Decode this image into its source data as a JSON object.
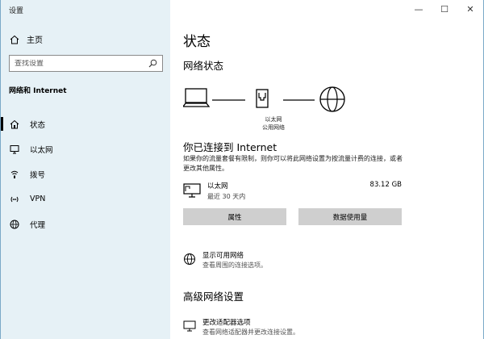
{
  "window": {
    "title": "设置"
  },
  "controls": {
    "minimize": "—",
    "maximize": "☐",
    "close": "✕"
  },
  "sidebar": {
    "home_label": "主页",
    "search_placeholder": "查找设置",
    "section_title": "网络和 Internet",
    "items": [
      {
        "label": "状态",
        "icon": "house-status-icon"
      },
      {
        "label": "以太网",
        "icon": "ethernet-monitor-icon"
      },
      {
        "label": "拨号",
        "icon": "dialup-icon"
      },
      {
        "label": "VPN",
        "icon": "vpn-icon"
      },
      {
        "label": "代理",
        "icon": "globe-icon"
      }
    ]
  },
  "main": {
    "title": "状态",
    "network_status_title": "网络状态",
    "diagram_label_line1": "以太网",
    "diagram_label_line2": "公用网络",
    "connection_title": "你已连接到 Internet",
    "connection_desc": "如果你的流量套餐有限制，则你可以将此网络设置为按流量计费的连接，或者更改其他属性。",
    "adapter": {
      "name": "以太网",
      "sub": "最近 30 天内",
      "usage": "83.12 GB"
    },
    "buttons": {
      "properties": "属性",
      "data_usage": "数据使用量"
    },
    "show_networks": {
      "title": "显示可用网络",
      "desc": "查看周围的连接选项。"
    },
    "advanced_title": "高级网络设置",
    "adapter_options": {
      "title": "更改适配器选项",
      "desc": "查看网络适配器并更改连接设置。"
    }
  }
}
